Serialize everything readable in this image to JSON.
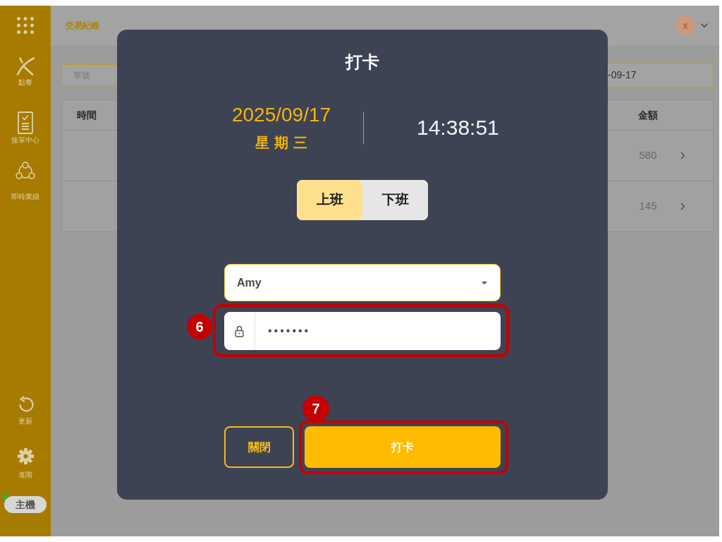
{
  "sidebar": {
    "items": [
      {
        "label": "點餐"
      },
      {
        "label": "接單中心"
      },
      {
        "label": "即時業績"
      }
    ],
    "bottom_items": [
      {
        "label": "更新"
      },
      {
        "label": "進階"
      }
    ],
    "host": {
      "label": "主機",
      "online": true
    }
  },
  "header": {
    "title": "交易紀錄",
    "avatar_initial": "x"
  },
  "filters": {
    "order_number": {
      "placeholder": "單號"
    },
    "date": {
      "value": "-09-17"
    }
  },
  "table": {
    "columns": [
      "時間",
      "金額"
    ],
    "rows": [
      {
        "amount": "580"
      },
      {
        "amount": "145"
      }
    ]
  },
  "punch_dialog": {
    "title": "打卡",
    "date": "2025/09/17",
    "weekday": "星期三",
    "time": "14:38:51",
    "shift_tabs": [
      {
        "label": "上班",
        "selected": true
      },
      {
        "label": "下班",
        "selected": false
      }
    ],
    "employee_select": {
      "value": "Amy"
    },
    "password_field": {
      "value": "•••••••",
      "callout": "6"
    },
    "buttons": [
      {
        "label": "關閉",
        "kind": "secondary"
      },
      {
        "label": "打卡",
        "kind": "primary",
        "callout": "7"
      }
    ]
  }
}
